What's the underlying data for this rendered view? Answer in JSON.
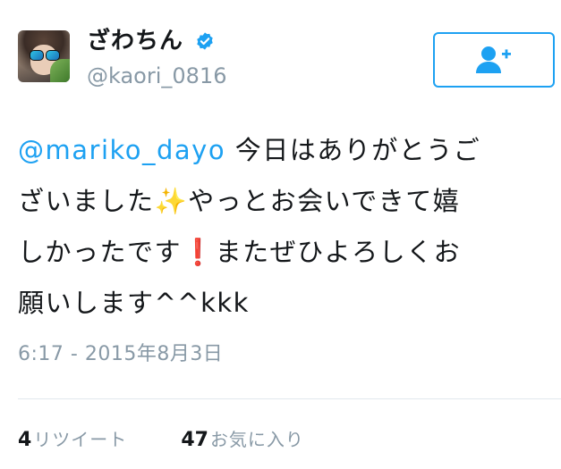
{
  "tweet": {
    "display_name": "ざわちん",
    "verified_icon": "verified-badge-icon",
    "handle": "@kaori_0816",
    "follow_button_icon": "follow-person-plus-icon",
    "text": {
      "mention": "@mariko_dayo",
      "line1_rest": " 今日はありがとうご",
      "line2_a": "ざいました",
      "sparkles": "✨",
      "line2_b": "やっとお会いできて嬉",
      "line3_a": "しかったです",
      "exclamation": "❗",
      "line3_b": "またぜひよろしくお",
      "line4": "願いします^^kkk"
    },
    "timestamp": "6:17 - 2015年8月3日",
    "stats": {
      "retweet_count": "4",
      "retweet_label": "リツイート",
      "favorite_count": "47",
      "favorite_label": "お気に入り"
    }
  },
  "colors": {
    "accent": "#1da1f2",
    "muted": "#8899a6",
    "text": "#14171a",
    "divider": "#e1e8ed"
  }
}
